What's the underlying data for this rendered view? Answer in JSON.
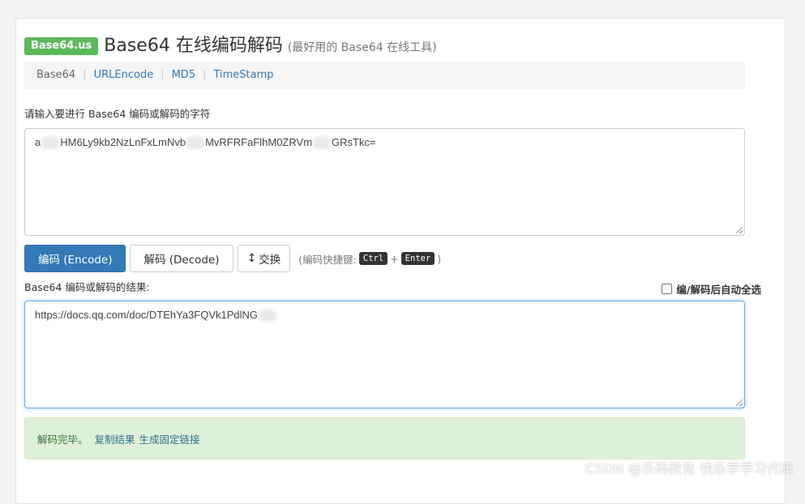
{
  "header": {
    "brand": "Base64.us",
    "title": "Base64 在线编码解码",
    "subtitle": "(最好用的 Base64 在线工具)"
  },
  "nav": {
    "items": [
      {
        "label": "Base64"
      },
      {
        "label": "URLEncode"
      },
      {
        "label": "MD5"
      },
      {
        "label": "TimeStamp"
      }
    ],
    "separator": "|"
  },
  "input": {
    "label": "请输入要进行 Base64 编码或解码的字符",
    "value_parts": [
      "a",
      "HM6Ly9kb2NzLnFxLmNvb",
      "MvRFRFaFlhM0ZRVm",
      "GRsTkc="
    ]
  },
  "toolbar": {
    "encode_label": "编码 (Encode)",
    "decode_label": "解码 (Decode)",
    "swap_label": "交换",
    "swap_icon": "↕",
    "shortcut_prefix": "(编码快捷键:",
    "shortcut_key1": "Ctrl",
    "shortcut_plus": "+",
    "shortcut_key2": "Enter",
    "shortcut_suffix": ")"
  },
  "result": {
    "label": "Base64 编码或解码的结果:",
    "auto_select_label": "编/解码后自动全选",
    "value": "https://docs.qq.com/doc/DTEhYa3FQVk1PdlNG"
  },
  "alert": {
    "status": "解码完毕。",
    "copy_link": "复制结果",
    "fixed_link": "生成固定链接"
  },
  "watermark": "CSDN @乐码教育 快乐学学习代码"
}
